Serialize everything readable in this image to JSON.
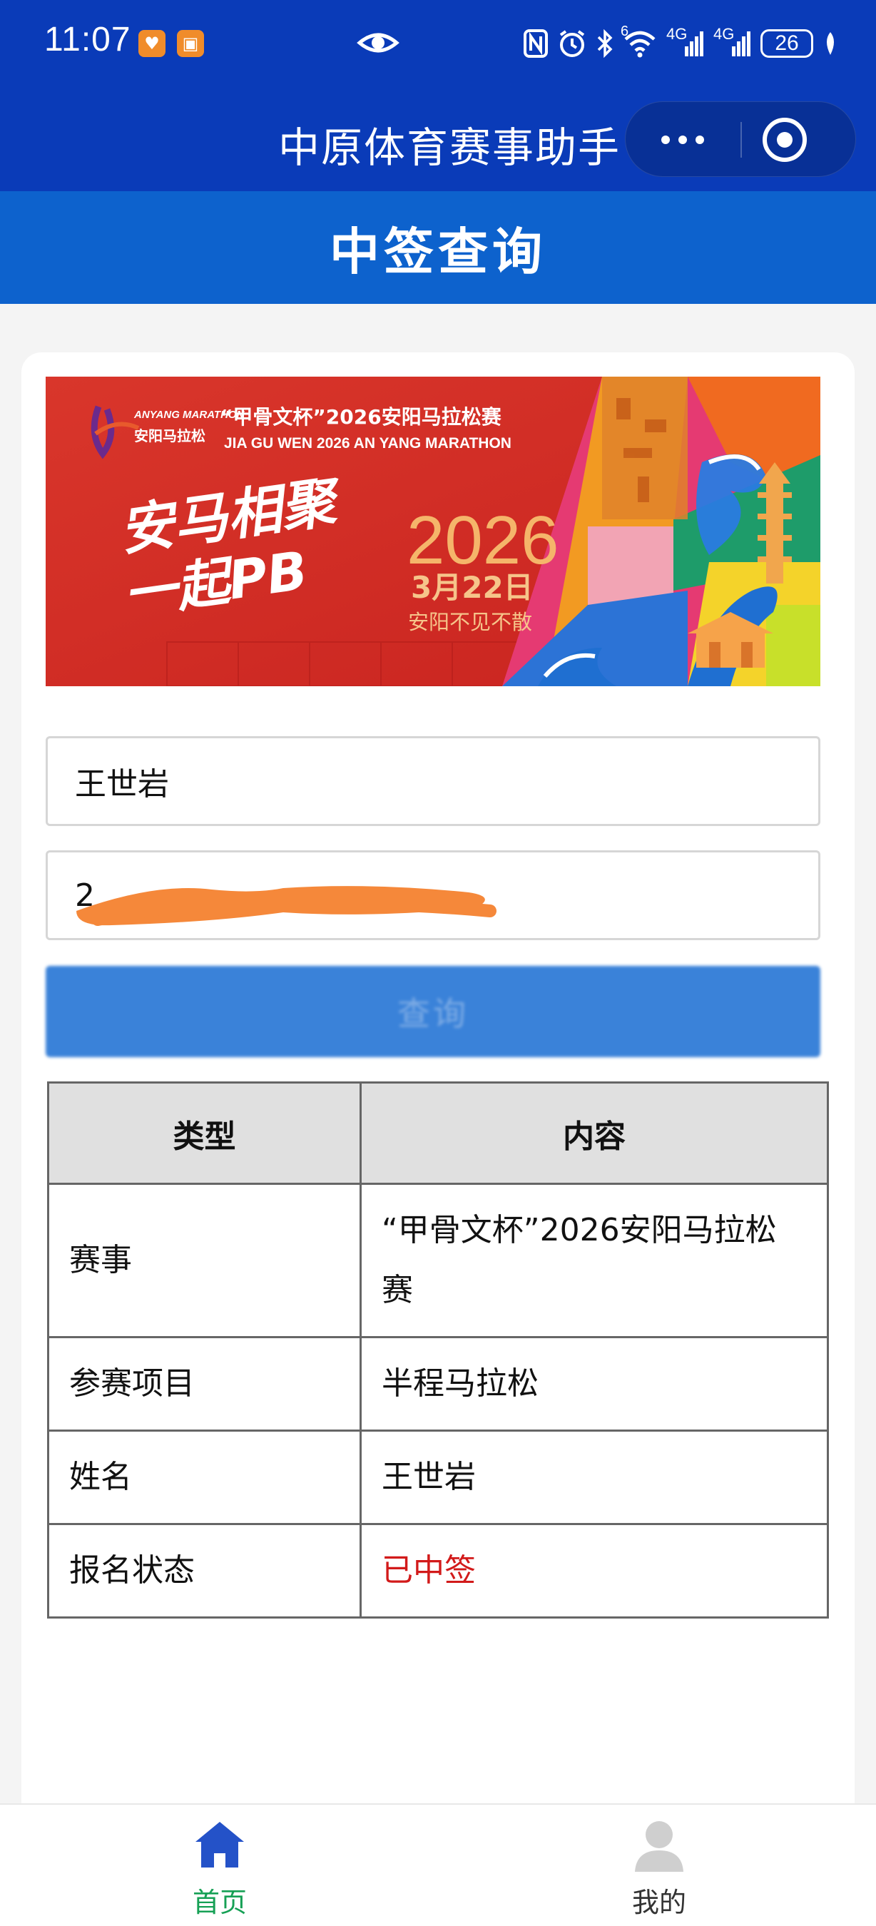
{
  "status_bar": {
    "time": "11:07",
    "network_1": "4G",
    "network_2": "4G",
    "wifi_badge": "6",
    "battery": "26"
  },
  "app_bar": {
    "title": "中原体育赛事助手"
  },
  "page": {
    "title": "中签查询"
  },
  "banner": {
    "logo_en": "ANYANG MARATHON",
    "logo_cn": "安阳马拉松",
    "event_title": "“甲骨文杯”2026安阳马拉松赛",
    "event_title_en": "JIA GU WEN 2026 AN YANG MARATHON",
    "slogan_1": "安马相聚",
    "slogan_2": "一起PB",
    "year": "2026",
    "date": "3月22日",
    "tagline": "安阳不见不散"
  },
  "form": {
    "name_value": "王世岩",
    "id_value_visible": "2",
    "query_button_label": "查询"
  },
  "result_table": {
    "headers": [
      "类型",
      "内容"
    ],
    "rows": [
      {
        "label": "赛事",
        "value": "“甲骨文杯”2026安阳马拉松赛"
      },
      {
        "label": "参赛项目",
        "value": "半程马拉松"
      },
      {
        "label": "姓名",
        "value": "王世岩"
      },
      {
        "label": "报名状态",
        "value": "已中签"
      }
    ]
  },
  "tab_bar": {
    "home_label": "首页",
    "mine_label": "我的"
  },
  "colors": {
    "title_bar": "#0a3bb8",
    "page_header": "#0d62cd",
    "button": "#3a82d9",
    "status_hit": "#d21a1a",
    "tab_active": "#16a055"
  }
}
